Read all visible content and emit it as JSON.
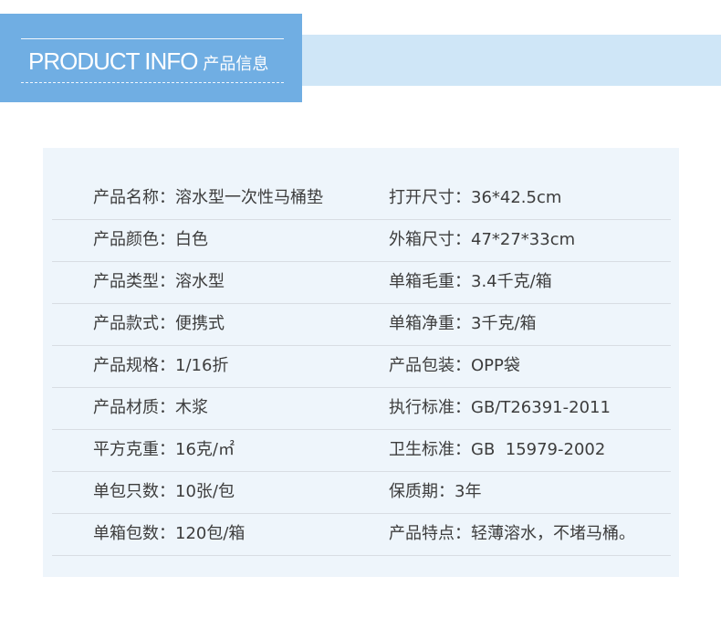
{
  "header": {
    "title_en": "PRODUCT INFO",
    "title_cn": "产品信息"
  },
  "specs": [
    {
      "left_label": "产品名称",
      "left_value": "溶水型一次性马桶垫",
      "right_label": "打开尺寸",
      "right_value": "36*42.5cm"
    },
    {
      "left_label": "产品颜色",
      "left_value": "白色",
      "right_label": "外箱尺寸",
      "right_value": "47*27*33cm"
    },
    {
      "left_label": "产品类型",
      "left_value": "溶水型",
      "right_label": "单箱毛重",
      "right_value": "3.4千克/箱"
    },
    {
      "left_label": "产品款式",
      "left_value": "便携式",
      "right_label": "单箱净重",
      "right_value": "3千克/箱"
    },
    {
      "left_label": "产品规格",
      "left_value": "1/16折",
      "right_label": "产品包装",
      "right_value": "OPP袋"
    },
    {
      "left_label": "产品材质",
      "left_value": "木浆",
      "right_label": "执行标准",
      "right_value": "GB/T26391-2011"
    },
    {
      "left_label": "平方克重",
      "left_value": "16克/㎡",
      "right_label": "卫生标准",
      "right_value": "GB  15979-2002"
    },
    {
      "left_label": "单包只数",
      "left_value": "10张/包",
      "right_label": "保质期",
      "right_value": "3年"
    },
    {
      "left_label": "单箱包数",
      "left_value": "120包/箱",
      "right_label": "产品特点",
      "right_value": "轻薄溶水，不堵马桶。"
    }
  ],
  "separator": "："
}
